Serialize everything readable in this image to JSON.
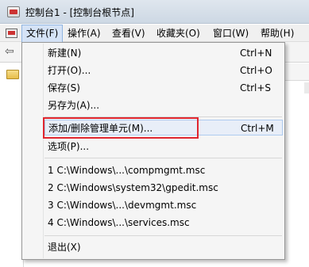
{
  "window": {
    "title": "控制台1 - [控制台根节点]"
  },
  "menubar": {
    "items": [
      "文件(F)",
      "操作(A)",
      "查看(V)",
      "收藏夹(O)",
      "窗口(W)",
      "帮助(H)"
    ]
  },
  "file_menu": {
    "items": [
      {
        "label": "新建(N)",
        "shortcut": "Ctrl+N"
      },
      {
        "label": "打开(O)...",
        "shortcut": "Ctrl+O"
      },
      {
        "label": "保存(S)",
        "shortcut": "Ctrl+S"
      },
      {
        "label": "另存为(A)...",
        "shortcut": ""
      },
      {
        "label": "添加/删除管理单元(M)...",
        "shortcut": "Ctrl+M"
      },
      {
        "label": "选项(P)...",
        "shortcut": ""
      },
      {
        "label": "1 C:\\Windows\\...\\compmgmt.msc",
        "shortcut": ""
      },
      {
        "label": "2 C:\\Windows\\system32\\gpedit.msc",
        "shortcut": ""
      },
      {
        "label": "3 C:\\Windows\\...\\devmgmt.msc",
        "shortcut": ""
      },
      {
        "label": "4 C:\\Windows\\...\\services.msc",
        "shortcut": ""
      },
      {
        "label": "退出(X)",
        "shortcut": ""
      }
    ]
  },
  "colors": {
    "highlight_box": "#e0262f",
    "menu_active": "#d5e3f6"
  }
}
